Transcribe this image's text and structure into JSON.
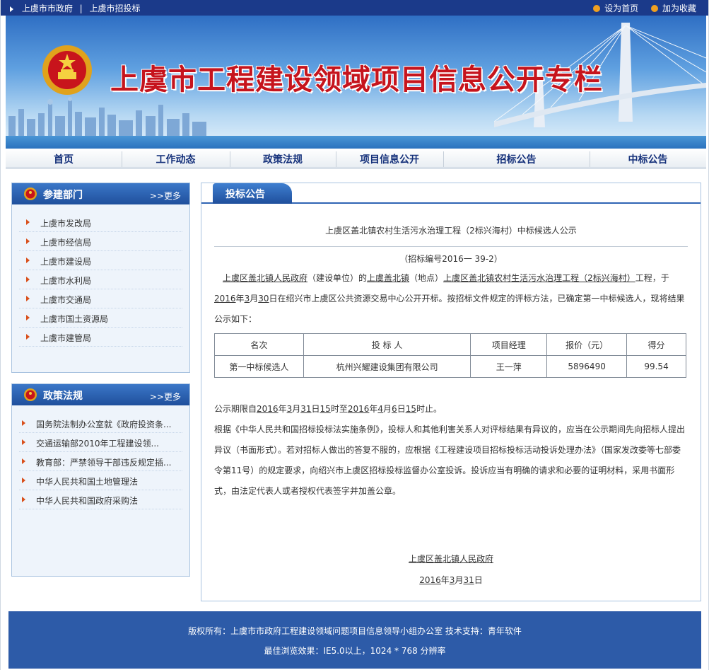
{
  "topbar": {
    "links": [
      "上虞市市政府",
      "上虞市招投标"
    ],
    "separator": "|",
    "right": [
      "设为首页",
      "加为收藏"
    ]
  },
  "banner": {
    "title": "上虞市工程建设领域项目信息公开专栏"
  },
  "nav": {
    "items": [
      "首页",
      "工作动态",
      "政策法规",
      "项目信息公开",
      "招标公告",
      "中标公告"
    ]
  },
  "sidebox1": {
    "title": "参建部门",
    "more": "更多",
    "items": [
      "上虞市发改局",
      "上虞市经信局",
      "上虞市建设局",
      "上虞市水利局",
      "上虞市交通局",
      "上虞市国土资源局",
      "上虞市建管局"
    ]
  },
  "sidebox2": {
    "title": "政策法规",
    "more": "更多",
    "items": [
      "国务院法制办公室就《政府投资条...",
      "交通运输部2010年工程建设领...",
      "教育部：严禁领导干部违反规定插...",
      "中华人民共和国土地管理法",
      "中华人民共和国政府采购法"
    ]
  },
  "main": {
    "tab": "投标公告",
    "title": "上虞区盖北镇农村生活污水治理工程（2标兴海村）中标候选人公示",
    "bid_no": "（招标编号2016一 39-2）",
    "intro": {
      "owner": "上虞区盖北镇人民政府",
      "owner_suffix": "（建设单位）的",
      "location": "上虞盖北镇",
      "location_suffix": "（地点）",
      "project": "上虞区盖北镇农村生活污水治理工程（2标兴海村）",
      "project_suffix": "工程，于",
      "year": "2016",
      "year_suffix": "年",
      "month": "3",
      "month_suffix": "月",
      "day": "30",
      "rest": "日在绍兴市上虞区公共资源交易中心公开开标。按招标文件规定的评标方法，已确定第一中标候选人，现将结果公示如下："
    },
    "table": {
      "headers": [
        "名次",
        "投 标 人",
        "项目经理",
        "报价（元）",
        "得分"
      ],
      "rows": [
        [
          "第一中标候选人",
          "杭州兴耀建设集团有限公司",
          "王一萍",
          "5896490",
          "99.54"
        ]
      ]
    },
    "notice_period": {
      "prefix": "公示期限自",
      "y1": "2016",
      "t1": "年",
      "m1": "3",
      "t2": "月",
      "d1": "31",
      "t3": "日",
      "h1": "15",
      "t4": "时至",
      "y2": "2016",
      "t5": "年",
      "m2": "4",
      "t6": "月",
      "d2": "6",
      "t7": "日",
      "h2": "15",
      "t8": "时止。"
    },
    "complaint": "根据《中华人民共和国招标投标法实施条例》，投标人和其他利害关系人对评标结果有异议的，应当在公示期间先向招标人提出异议（书面形式）。若对招标人做出的答复不服的，应根据《工程建设项目招标投标活动投诉处理办法》（国家发改委等七部委令第11号）的规定要求，向绍兴市上虞区招标投标监督办公室投诉。投诉应当有明确的请求和必要的证明材料，采用书面形式，由法定代表人或者授权代表签字并加盖公章。",
    "signature": "上虞区盖北镇人民政府",
    "sign_date": {
      "year": "2016",
      "t1": "年",
      "month": "3",
      "t2": "月",
      "day": "31",
      "t3": "日"
    }
  },
  "footer": {
    "line1": "版权所有：上虞市市政府工程建设领域问题项目信息领导小组办公室 技术支持：青年软件",
    "line2": "最佳浏览效果：IE5.0以上，1024 * 768 分辨率"
  }
}
